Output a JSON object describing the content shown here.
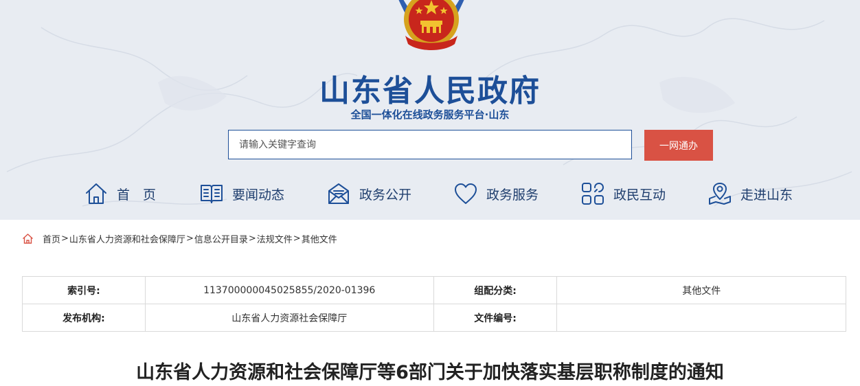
{
  "header": {
    "title": "山东省人民政府",
    "subtitle": "全国一体化在线政务服务平台·山东",
    "search": {
      "placeholder": "请输入关键字查询",
      "button_label": "一网通办"
    },
    "colors": {
      "brand": "#1d4f98",
      "accent": "#d95244"
    }
  },
  "nav": {
    "items": [
      {
        "label": "首　页",
        "icon": "home-icon"
      },
      {
        "label": "要闻动态",
        "icon": "book-icon"
      },
      {
        "label": "政务公开",
        "icon": "mail-icon"
      },
      {
        "label": "政务服务",
        "icon": "heart-icon"
      },
      {
        "label": "政民互动",
        "icon": "interaction-icon"
      },
      {
        "label": "走进山东",
        "icon": "location-icon"
      }
    ]
  },
  "breadcrumb": {
    "icon": "home-icon",
    "items": [
      "首页",
      "山东省人力资源和社会保障厅",
      "信息公开目录",
      "法规文件",
      "其他文件"
    ],
    "separator": ">"
  },
  "info": {
    "index_label": "索引号:",
    "index_value": "113700000045025855/2020-01396",
    "category_label": "组配分类:",
    "category_value": "其他文件",
    "publisher_label": "发布机构:",
    "publisher_value": "山东省人力资源社会保障厅",
    "doc_no_label": "文件编号:",
    "doc_no_value": ""
  },
  "document": {
    "title": "山东省人力资源和社会保障厅等6部门关于加快落实基层职称制度的通知"
  }
}
